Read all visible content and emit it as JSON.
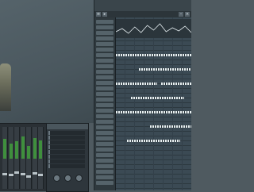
{
  "playlist": {
    "title": "",
    "automation_peaks": [
      6,
      10,
      4,
      12,
      5,
      14,
      8,
      16,
      6,
      11,
      7,
      13,
      5
    ],
    "patterns": [
      {
        "track": 1,
        "start": 0.0,
        "end": 1.0
      },
      {
        "track": 2,
        "start": 0.3,
        "end": 1.0
      },
      {
        "track": 3,
        "start": 0.0,
        "end": 0.55
      },
      {
        "track": 3,
        "start": 0.6,
        "end": 1.0
      },
      {
        "track": 4,
        "start": 0.2,
        "end": 0.9
      },
      {
        "track": 5,
        "start": 0.0,
        "end": 1.0
      },
      {
        "track": 6,
        "start": 0.45,
        "end": 1.0
      },
      {
        "track": 7,
        "start": 0.15,
        "end": 0.85
      }
    ]
  },
  "mixer": {
    "channel_levels": [
      0.62,
      0.48,
      0.55,
      0.7,
      0.4,
      0.66,
      0.58
    ],
    "fader_positions": [
      0.55,
      0.5,
      0.6,
      0.52,
      0.45,
      0.58,
      0.5
    ]
  },
  "plugin": {
    "slot_count": 8
  },
  "colors": {
    "accent": "#3f8f3d",
    "background": "#4f5a60",
    "panel": "#2e363c"
  }
}
